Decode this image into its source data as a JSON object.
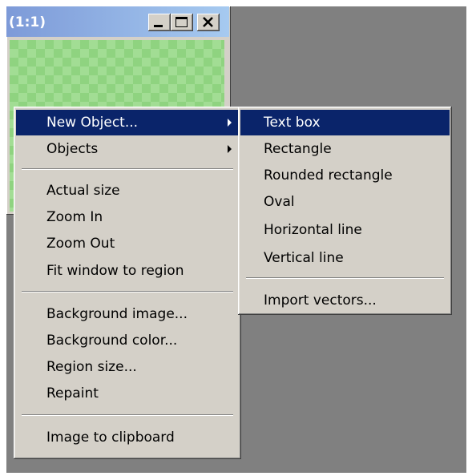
{
  "window": {
    "title": "(1:1)",
    "buttons": [
      {
        "name": "minimize-icon"
      },
      {
        "name": "maximize-icon"
      },
      {
        "name": "close-icon"
      }
    ]
  },
  "context_menu": {
    "items": [
      {
        "label": "New Object...",
        "submenu": true,
        "highlighted": true
      },
      {
        "label": "Objects",
        "submenu": true
      },
      {
        "label": "Actual size"
      },
      {
        "label": "Zoom In"
      },
      {
        "label": "Zoom Out"
      },
      {
        "label": "Fit window to region"
      },
      {
        "label": "Background image..."
      },
      {
        "label": "Background color..."
      },
      {
        "label": "Region size..."
      },
      {
        "label": "Repaint"
      },
      {
        "label": "Image to clipboard"
      }
    ]
  },
  "submenu": {
    "items": [
      {
        "label": "Text box",
        "highlighted": true
      },
      {
        "label": "Rectangle"
      },
      {
        "label": "Rounded rectangle"
      },
      {
        "label": "Oval"
      },
      {
        "label": "Horizontal line"
      },
      {
        "label": "Vertical line"
      },
      {
        "label": "Import vectors..."
      }
    ]
  },
  "colors": {
    "highlight": "#0a246a",
    "menu_face": "#d4d0c8",
    "desktop": "#808080",
    "canvas_green": "#8fd380"
  }
}
